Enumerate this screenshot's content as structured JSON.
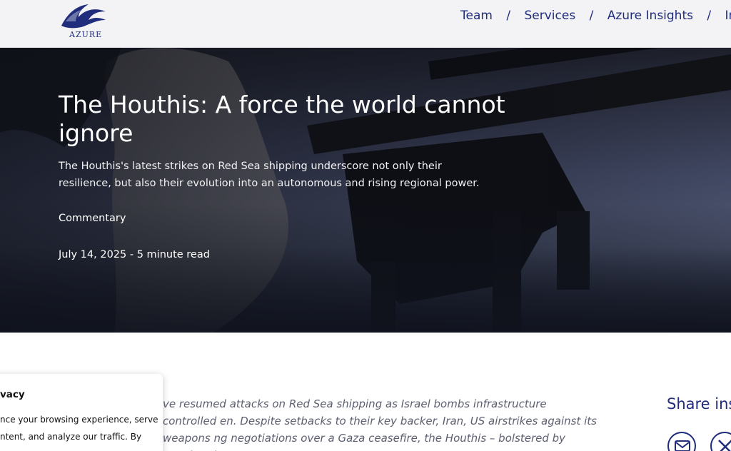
{
  "header": {
    "logo_text": "AZURE",
    "nav": [
      {
        "label": "Team"
      },
      {
        "label": "Services"
      },
      {
        "label": "Azure Insights"
      },
      {
        "label": "In th"
      }
    ],
    "separator": "/"
  },
  "hero": {
    "title": "The Houthis: A force the world cannot ignore",
    "subtitle": "The Houthis's latest strikes on Red Sea shipping underscore not only their resilience, but also their evolution into an autonomous and rising regional power.",
    "category": "Commentary",
    "meta": "July 14, 2025 - 5 minute read"
  },
  "article": {
    "lead": "ve resumed attacks on Red Sea shipping as Israel bombs infrastructure controlled en. Despite setbacks to their key backer, Iran, US airstrikes against its weapons ng negotiations over a Gaza ceasefire, the Houthis – bolstered by growing ties to"
  },
  "share": {
    "label": "Share ins",
    "icons": [
      "mail-icon",
      "x-icon"
    ]
  },
  "privacy": {
    "title": "vacy",
    "text": "nce your browsing experience, serve ntent, and analyze our traffic. By"
  },
  "colors": {
    "brand": "#1f2d7c",
    "header_bg": "#f3f3f5",
    "lead_text": "#5c5f70"
  }
}
